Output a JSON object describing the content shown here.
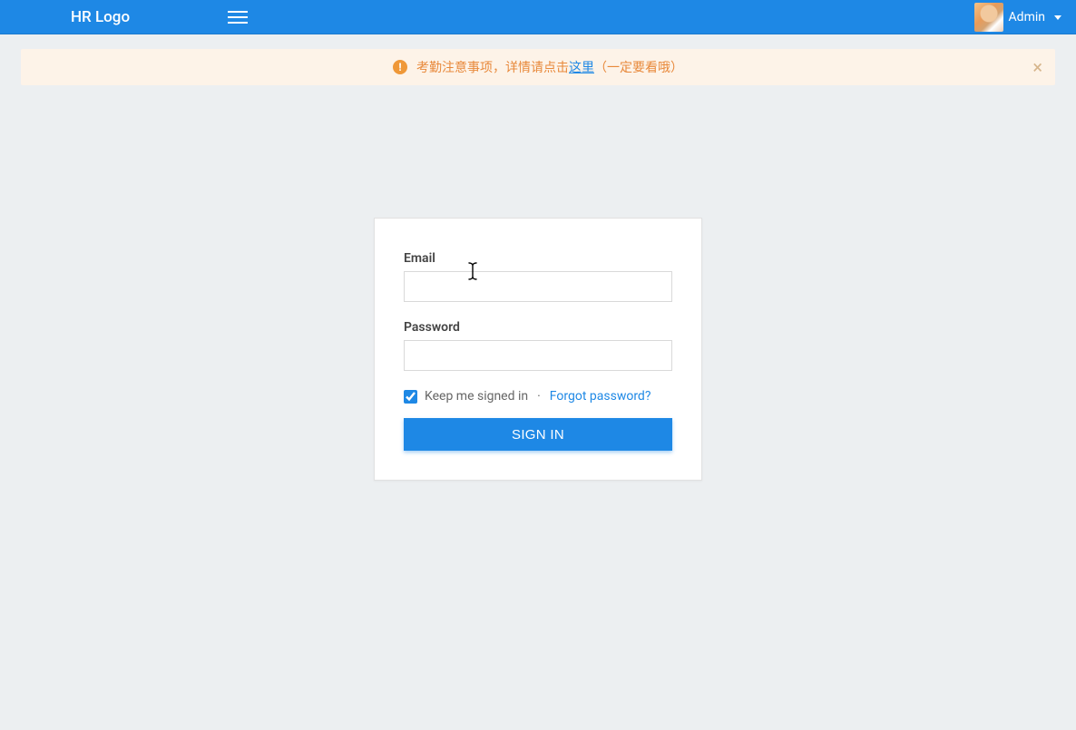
{
  "navbar": {
    "brand": "HR Logo",
    "user_name": "Admin"
  },
  "alert": {
    "text_before_link": "考勤注意事项，详情请点击",
    "link_text": "这里",
    "text_after_link": "（一定要看哦）",
    "close_symbol": "×"
  },
  "login": {
    "email_label": "Email",
    "email_value": "",
    "password_label": "Password",
    "password_value": "",
    "keep_signed_in_checked": true,
    "keep_signed_in_label": "Keep me signed in",
    "separator": "·",
    "forgot_password_label": "Forgot password?",
    "signin_button_label": "SIGN IN"
  },
  "colors": {
    "primary": "#1e88e5",
    "alert_bg": "#fdf3e8",
    "alert_text": "#e8893b",
    "body_bg": "#eceff1"
  }
}
